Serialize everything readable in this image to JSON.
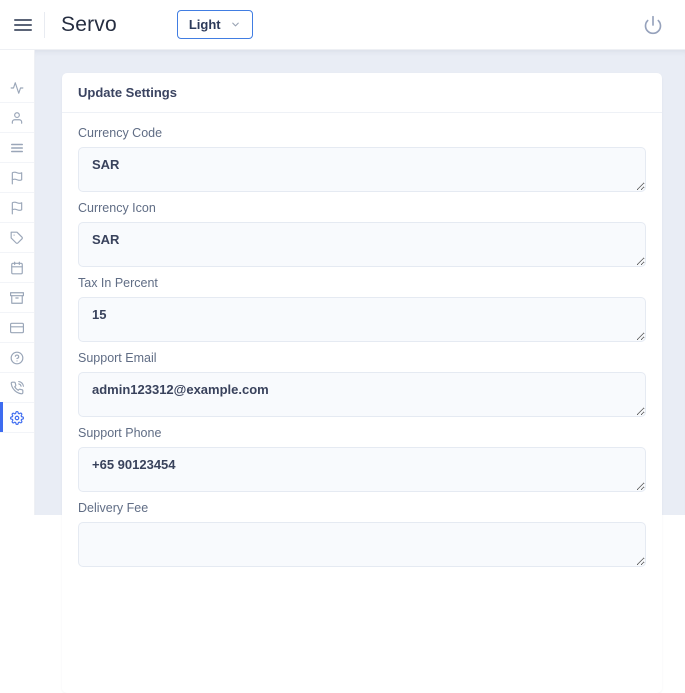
{
  "header": {
    "brand": "Servo",
    "theme_dropdown": {
      "value": "Light"
    }
  },
  "sidebar": {
    "items": [
      {
        "icon": "activity-icon",
        "active": false
      },
      {
        "icon": "user-icon",
        "active": false
      },
      {
        "icon": "list-icon",
        "active": false
      },
      {
        "icon": "flag-icon",
        "active": false
      },
      {
        "icon": "flag-icon",
        "active": false
      },
      {
        "icon": "tag-icon",
        "active": false
      },
      {
        "icon": "calendar-icon",
        "active": false
      },
      {
        "icon": "package-icon",
        "active": false
      },
      {
        "icon": "credit-card-icon",
        "active": false
      },
      {
        "icon": "help-circle-icon",
        "active": false
      },
      {
        "icon": "phone-call-icon",
        "active": false
      },
      {
        "icon": "settings-icon",
        "active": true
      }
    ]
  },
  "main": {
    "card": {
      "title": "Update Settings",
      "fields": [
        {
          "label": "Currency Code",
          "value": "SAR"
        },
        {
          "label": "Currency Icon",
          "value": "SAR"
        },
        {
          "label": "Tax In Percent",
          "value": "15"
        },
        {
          "label": "Support Email",
          "value": "admin123312@example.com"
        },
        {
          "label": "Support Phone",
          "value": "+65 90123454"
        },
        {
          "label": "Delivery Fee",
          "value": ""
        }
      ]
    }
  },
  "colors": {
    "accent_blue": "#3e6cf0",
    "theme_button_border": "#417de2",
    "page_background": "#e9edf5",
    "card_background": "#ffffff",
    "input_background": "#f8fafd",
    "input_border": "#e5eaf2",
    "label_text": "#606d85",
    "value_text": "#39425c",
    "icon_gray": "#9aa6b8"
  }
}
